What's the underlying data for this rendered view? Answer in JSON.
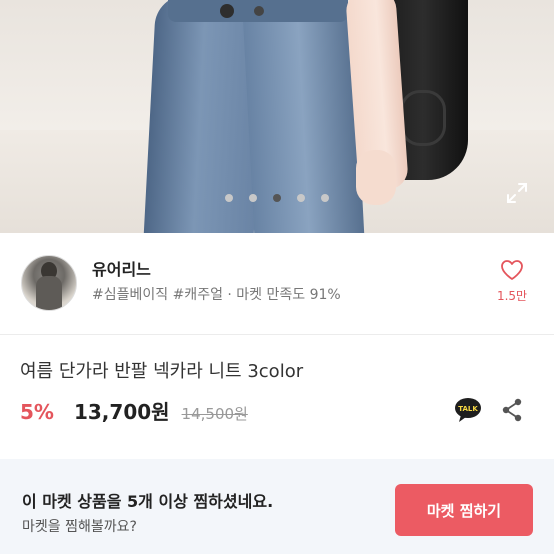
{
  "gallery": {
    "total_images": 5,
    "active_index": 2,
    "expand_icon": "expand-icon"
  },
  "shop": {
    "name": "유어리느",
    "tags": "#심플베이직 #캐주얼 · 마켓 만족도 91%",
    "like_count": "1.5만",
    "heart_icon": "heart-outline-icon",
    "accent_color": "#e4555c"
  },
  "product": {
    "title": "여름 단가라 반팔 넥카라 니트 3color",
    "discount": "5%",
    "price": "13,700원",
    "original_price": "14,500원",
    "talk_label": "TALK",
    "share_icon": "share-icon"
  },
  "banner": {
    "main_text": "이 마켓 상품을 5개 이상 찜하셨네요.",
    "sub_text": "마켓을 찜해볼까요?",
    "cta_label": "마켓 찜하기",
    "cta_color": "#ec5b63"
  }
}
